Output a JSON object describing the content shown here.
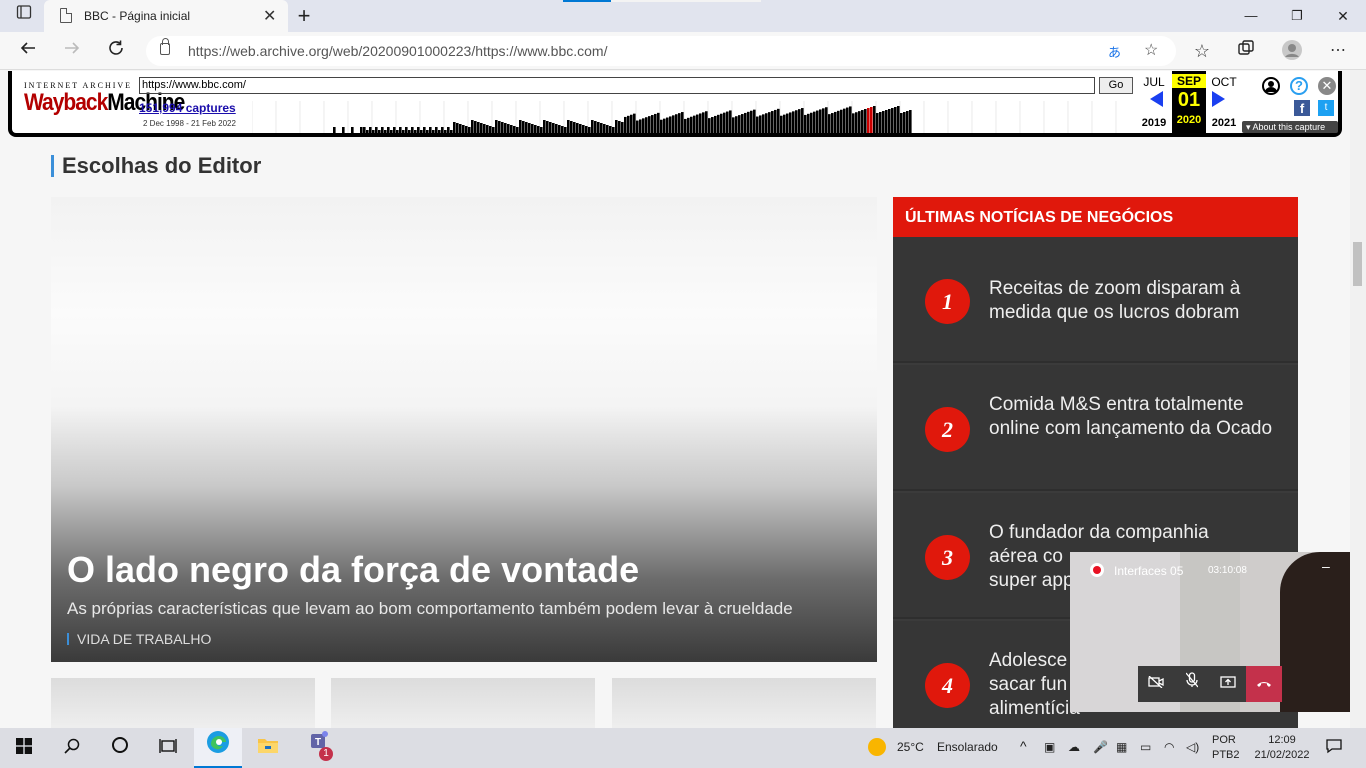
{
  "browser": {
    "tab_title": "BBC - Página inicial",
    "tab_close": "✕",
    "new_tab": "+",
    "url": "https://web.archive.org/web/20200901000223/https://www.bbc.com/",
    "window_controls": {
      "minimize": "—",
      "maximize": "❐",
      "close": "✕"
    }
  },
  "wayback": {
    "logo_top": "INTERNET ARCHIVE",
    "logo_wayback": "Wayback",
    "logo_machine": "Machine",
    "url_value": "https://www.bbc.com/",
    "go_label": "Go",
    "captures": "151,994 captures",
    "range": "2 Dec 1998 - 21 Feb 2022",
    "prev_month": "JUL",
    "cur_month": "SEP",
    "next_month": "OCT",
    "cur_day": "01",
    "prev_year": "2019",
    "cur_year": "2020",
    "next_year": "2021",
    "about": "About this capture",
    "help": "?"
  },
  "page": {
    "section_title": "Escolhas do Editor",
    "hero": {
      "title": "O lado negro da força de vontade",
      "subtitle": "As próprias características que levam ao bom comportamento também podem levar à crueldade",
      "tag": "VIDA DE TRABALHO"
    },
    "news": {
      "header": "ÚLTIMAS NOTÍCIAS DE NEGÓCIOS",
      "items": [
        {
          "num": "1",
          "text": "Receitas de zoom disparam à medida que os lucros dobram"
        },
        {
          "num": "2",
          "text": "Comida M&S entra totalmente online com lançamento da Ocado"
        },
        {
          "num": "3",
          "text": "O fundador da companhia aérea co..."
        },
        {
          "num": "4",
          "text": "Adolesce... sacar fun... alimentícia"
        }
      ],
      "item3_visible": "O fundador da companhia aérea co super app",
      "item3_line1": "O fundador da companhia",
      "item3_line2": "aérea co",
      "item3_line3": "super app",
      "item4_line1": "Adolesce",
      "item4_line2": "sacar fun",
      "item4_line3": "alimentícia"
    }
  },
  "teams": {
    "meeting_name": "Interfaces 05",
    "duration": "03:10:08",
    "minimize": "–"
  },
  "taskbar": {
    "weather_temp": "25°C",
    "weather_desc": "Ensolarado",
    "lang1": "POR",
    "lang2": "PTB2",
    "time": "12:09",
    "date": "21/02/2022",
    "teams_badge": "1"
  },
  "colors": {
    "bbc_red": "#e0180c",
    "news_bg": "#363636",
    "accent_blue": "#3b8fd9"
  }
}
